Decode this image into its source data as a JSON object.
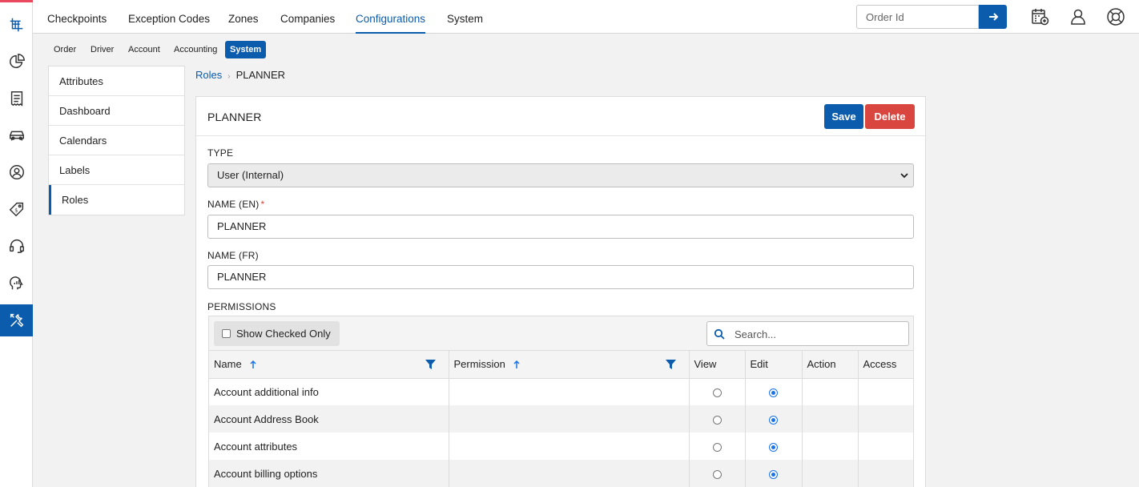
{
  "top_nav": {
    "tabs": [
      "Checkpoints",
      "Exception Codes",
      "Zones",
      "Companies",
      "Configurations",
      "System"
    ],
    "active_tab": "Configurations",
    "order_placeholder": "Order Id"
  },
  "sub_nav": {
    "tabs": [
      "Order",
      "Driver",
      "Account",
      "Accounting",
      "System"
    ],
    "active_tab": "System"
  },
  "side_menu": {
    "items": [
      "Attributes",
      "Dashboard",
      "Calendars",
      "Labels",
      "Roles"
    ],
    "active_item": "Roles"
  },
  "breadcrumb": {
    "parent": "Roles",
    "current": "PLANNER"
  },
  "form": {
    "title": "PLANNER",
    "save_label": "Save",
    "delete_label": "Delete",
    "type_label": "TYPE",
    "type_value": "User (Internal)",
    "name_en_label": "NAME (EN)",
    "required_mark": "*",
    "name_en_value": "PLANNER",
    "name_fr_label": "NAME (FR)",
    "name_fr_value": "PLANNER",
    "permissions_label": "PERMISSIONS"
  },
  "permissions": {
    "show_checked_label": "Show Checked Only",
    "search_placeholder": "Search...",
    "columns": [
      "Name",
      "Permission",
      "View",
      "Edit",
      "Action",
      "Access"
    ],
    "rows": [
      {
        "name": "Account additional info",
        "permission": "",
        "view": false,
        "edit": true
      },
      {
        "name": "Account Address Book",
        "permission": "",
        "view": false,
        "edit": true
      },
      {
        "name": "Account attributes",
        "permission": "",
        "view": false,
        "edit": true
      },
      {
        "name": "Account billing options",
        "permission": "",
        "view": false,
        "edit": true
      }
    ]
  },
  "colors": {
    "primary": "#0b5cad",
    "danger": "#d9463f",
    "brand_accent": "#e8495f",
    "radio_selected": "#1a73e8"
  },
  "rail_icons": [
    "logo-icon",
    "dashboard-pie-icon",
    "document-list-icon",
    "car-icon",
    "user-circle-icon",
    "price-tag-icon",
    "headset-icon",
    "analytics-head-icon",
    "tools-icon"
  ],
  "top_icons": [
    "calendar-add-icon",
    "user-profile-icon",
    "help-lifebuoy-icon"
  ]
}
